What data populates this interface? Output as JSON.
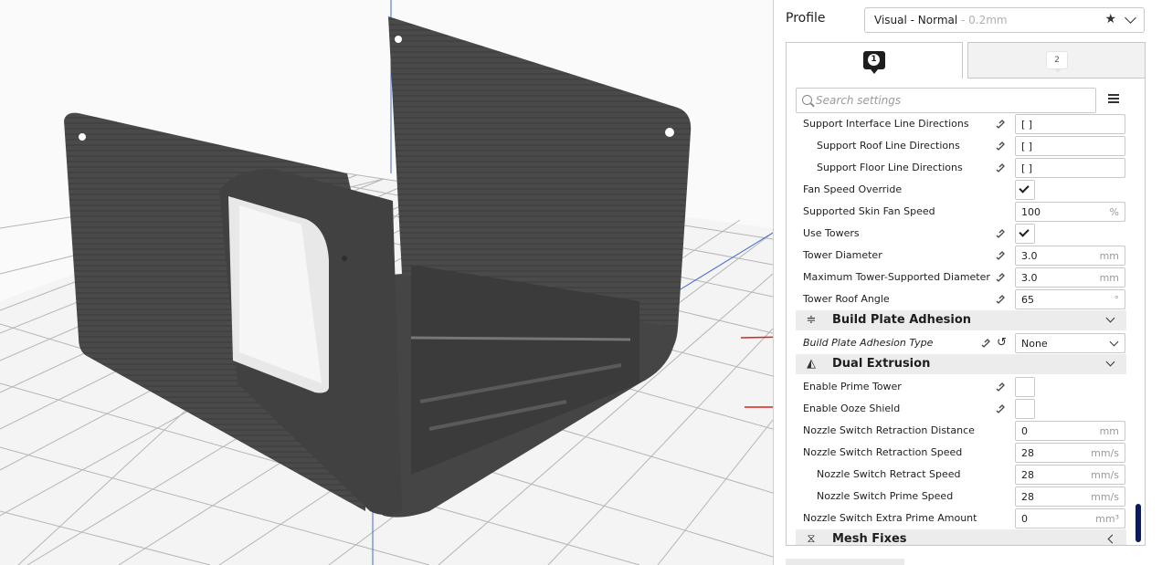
{
  "profile": {
    "label": "Profile",
    "name": "Visual - Normal",
    "layer": " - 0.2mm"
  },
  "tabs": [
    {
      "badge": "1"
    },
    {
      "badge": "2"
    }
  ],
  "search": {
    "placeholder": "Search settings"
  },
  "settings": [
    {
      "label": "Support Interface Line Directions",
      "value": "[ ]"
    },
    {
      "label": "Support Roof Line Directions",
      "value": "[ ]"
    },
    {
      "label": "Support Floor Line Directions",
      "value": "[ ]"
    },
    {
      "label": "Fan Speed Override",
      "checked": true
    },
    {
      "label": "Supported Skin Fan Speed",
      "value": "100",
      "unit": "%"
    },
    {
      "label": "Use Towers",
      "checked": true
    },
    {
      "label": "Tower Diameter",
      "value": "3.0",
      "unit": "mm"
    },
    {
      "label": "Maximum Tower-Supported Diameter",
      "value": "3.0",
      "unit": "mm"
    },
    {
      "label": "Tower Roof Angle",
      "value": "65",
      "unit": "°"
    },
    {
      "category": "Build Plate Adhesion"
    },
    {
      "label": "Build Plate Adhesion Type",
      "value": "None"
    },
    {
      "category": "Dual Extrusion"
    },
    {
      "label": "Enable Prime Tower",
      "checked": false
    },
    {
      "label": "Enable Ooze Shield",
      "checked": false
    },
    {
      "label": "Nozzle Switch Retraction Distance",
      "value": "0",
      "unit": "mm"
    },
    {
      "label": "Nozzle Switch Retraction Speed",
      "value": "28",
      "unit": "mm/s"
    },
    {
      "label": "Nozzle Switch Retract Speed",
      "value": "28",
      "unit": "mm/s"
    },
    {
      "label": "Nozzle Switch Prime Speed",
      "value": "28",
      "unit": "mm/s"
    },
    {
      "label": "Nozzle Switch Extra Prime Amount",
      "value": "0",
      "unit": "mm³"
    },
    {
      "category": "Mesh Fixes"
    }
  ],
  "colors": {
    "accent": "#0b1a5e",
    "model": "#474747",
    "arrow": "#e0201c"
  }
}
